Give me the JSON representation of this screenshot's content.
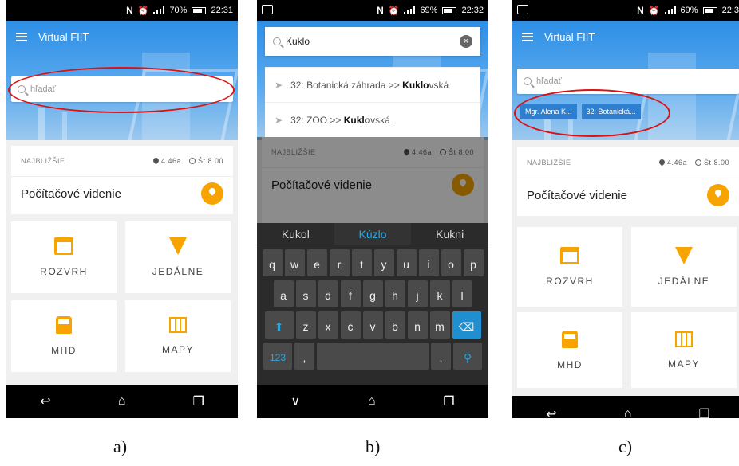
{
  "panel_a": {
    "status": {
      "battery": "70%",
      "time": "22:31"
    },
    "app_title": "Virtual FIIT",
    "search_placeholder": "hľadať",
    "nearest": {
      "header": "NAJBLIŽŠIE",
      "room": "4.46a",
      "time": "Št 8.00",
      "course": "Počítačové videnie"
    },
    "tiles": [
      "ROZVRH",
      "JEDÁLNE",
      "MHD",
      "MAPY"
    ],
    "caption": "a)"
  },
  "panel_b": {
    "status": {
      "battery": "69%",
      "time": "22:32"
    },
    "search_value": "Kuklo",
    "suggestions": [
      {
        "prefix": "32: Botanická záhrada >> ",
        "bold": "Kuklo",
        "suffix": "vská"
      },
      {
        "prefix": "32: ZOO >> ",
        "bold": "Kuklo",
        "suffix": "vská"
      }
    ],
    "nearest": {
      "header": "NAJBLIŽŠIE",
      "room": "4.46a",
      "time": "Št 8.00",
      "course": "Počítačové videnie"
    },
    "predictions": [
      "Kukol",
      "Kúzlo",
      "Kukni"
    ],
    "keyboard_rows": [
      [
        "q",
        "w",
        "e",
        "r",
        "t",
        "y",
        "u",
        "i",
        "o",
        "p"
      ],
      [
        "a",
        "s",
        "d",
        "f",
        "g",
        "h",
        "j",
        "k",
        "l"
      ],
      [
        "z",
        "x",
        "c",
        "v",
        "b",
        "n",
        "m"
      ]
    ],
    "num_key": "123",
    "caption": "b)"
  },
  "panel_c": {
    "status": {
      "battery": "69%",
      "time": "22:3"
    },
    "app_title": "Virtual FIIT",
    "search_placeholder": "hľadať",
    "chips": [
      "Mgr. Alena K...",
      "32: Botanická..."
    ],
    "nearest": {
      "header": "NAJBLIŽŠIE",
      "room": "4.46a",
      "time": "Št 8.00",
      "course": "Počítačové videnie"
    },
    "tiles": [
      "ROZVRH",
      "JEDÁLNE",
      "MHD",
      "MAPY"
    ],
    "caption": "c)"
  },
  "colors": {
    "accent": "#f7a400",
    "primary": "#2d8fe6",
    "highlight": "#d11111"
  }
}
